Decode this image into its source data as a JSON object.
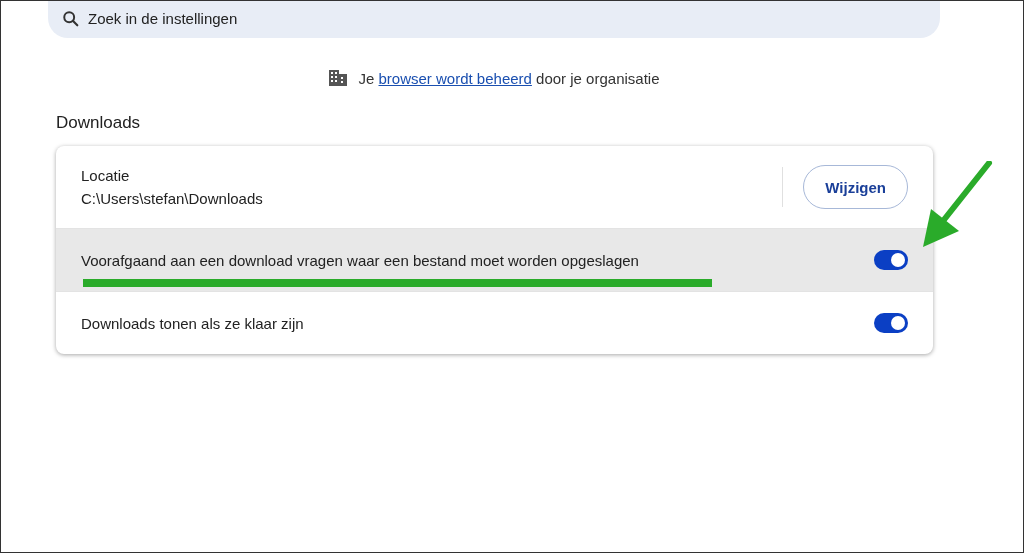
{
  "search": {
    "placeholder": "Zoek in de instellingen"
  },
  "managed_notice": {
    "before": "Je",
    "link": "browser wordt beheerd",
    "after": "door je organisatie"
  },
  "section": {
    "title": "Downloads"
  },
  "location": {
    "label": "Locatie",
    "path": "C:\\Users\\stefan\\Downloads",
    "button": "Wijzigen"
  },
  "settings": [
    {
      "label": "Voorafgaand aan een download vragen waar een bestand moet worden opgeslagen",
      "on": true,
      "highlighted": true,
      "underlined": true
    },
    {
      "label": "Downloads tonen als ze klaar zijn",
      "on": true,
      "highlighted": false,
      "underlined": false
    }
  ],
  "annotation": {
    "arrow": true
  }
}
